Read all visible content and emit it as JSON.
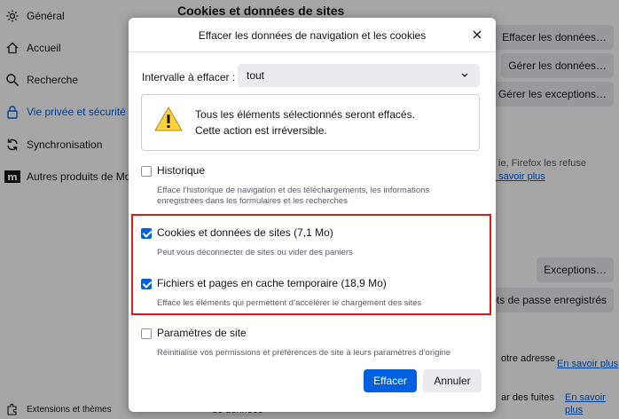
{
  "sidebar": {
    "items": [
      {
        "label": "Général"
      },
      {
        "label": "Accueil"
      },
      {
        "label": "Recherche"
      },
      {
        "label": "Vie privée et sécurité"
      },
      {
        "label": "Synchronisation"
      },
      {
        "label": "Autres produits de Mozilla"
      }
    ],
    "footer_label": "Extensions et thèmes"
  },
  "background": {
    "heading": "Cookies et données de sites",
    "btn_clear": "Effacer les données…",
    "btn_manage": "Gérer les données…",
    "btn_exceptions": "Gérer les exceptions…",
    "text_refuse": "ie, Firefox les refuse",
    "link_learn1": "n savoir plus",
    "btn_exceptions2": "Exceptions…",
    "btn_passwords": "Mots de passe enregistrés",
    "text_adresse": "otre adresse",
    "link_learn2": "En savoir plus",
    "text_fuites": "ar des fuites",
    "link_learn3a": "En savoir",
    "link_learn3b": "plus",
    "text_donnees": "de données"
  },
  "dialog": {
    "title": "Effacer les données de navigation et les cookies",
    "range_label": "Intervalle à effacer :",
    "range_value": "tout",
    "warning_line1": "Tous les éléments sélectionnés seront effacés.",
    "warning_line2": "Cette action est irréversible.",
    "options": [
      {
        "label": "Historique",
        "checked": false,
        "description": "Efface l’historique de navigation et des téléchargements, les informations enregistrées dans les formulaires et les recherches"
      },
      {
        "label": "Cookies et données de sites (7,1 Mo)",
        "checked": true,
        "description": "Peut vous déconnecter de sites ou vider des paniers"
      },
      {
        "label": "Fichiers et pages en cache temporaire (18,9 Mo)",
        "checked": true,
        "description": "Efface les éléments qui permettent d’accélérer le chargement des sites"
      },
      {
        "label": "Paramètres de site",
        "checked": false,
        "description": "Réinitialise vos permissions et préférences de site à leurs paramètres d’origine"
      }
    ],
    "btn_confirm": "Effacer",
    "btn_cancel": "Annuler"
  },
  "colors": {
    "accent": "#0061e0",
    "highlight": "#e0191b"
  }
}
